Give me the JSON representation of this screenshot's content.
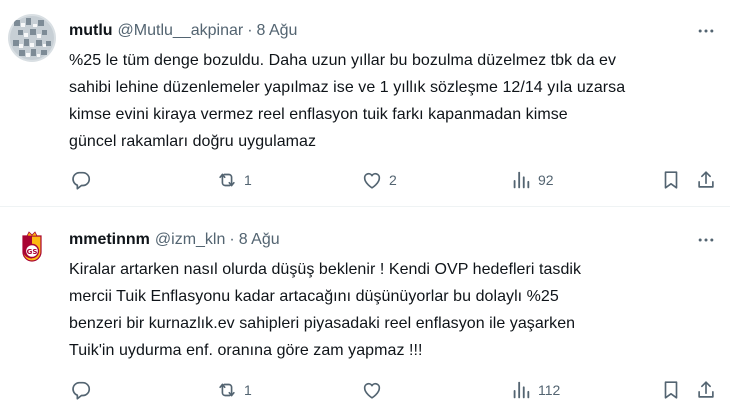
{
  "tweets": [
    {
      "author_name": "mutlu",
      "handle": "@Mutlu__akpinar",
      "separator": "·",
      "date": "8 Ağu",
      "lines": [
        "%25 le tüm denge bozuldu. Daha uzun yıllar bu bozulma düzelmez tbk da ev",
        "sahibi lehine düzenlemeler yapılmaz ise ve 1 yıllık sözleşme 12/14 yıla uzarsa",
        "kimse evini kiraya vermez reel enflasyon tuik farkı kapanmadan kimse",
        "güncel rakamları doğru uygulamaz"
      ],
      "reply_count": "",
      "retweet_count": "1",
      "like_count": "2",
      "view_count": "92",
      "avatar_icon": "geometric-mosaic-avatar"
    },
    {
      "author_name": "mmetinnm",
      "handle": "@izm_kln",
      "separator": "·",
      "date": "8 Ağu",
      "lines": [
        "Kiralar artarken nasıl olurda düşüş beklenir ! Kendi OVP hedefleri tasdik",
        "mercii Tuik  Enflasyonu kadar artacağını düşünüyorlar bu dolaylı %25",
        "benzeri bir kurnazlık.ev sahipleri piyasadaki reel enflasyon ile yaşarken",
        "Tuik'in uydurma enf. oranına göre zam yapmaz !!!"
      ],
      "reply_count": "",
      "retweet_count": "1",
      "like_count": "",
      "view_count": "112",
      "avatar_icon": "galatasaray-crest-avatar"
    }
  ],
  "colors": {
    "text_primary": "#0f1419",
    "text_secondary": "#536471",
    "divider": "#eff3f4",
    "gs_red": "#a90432",
    "gs_yellow": "#fdb912"
  },
  "icons": [
    "reply-icon",
    "retweet-icon",
    "like-icon",
    "views-icon",
    "bookmark-icon",
    "share-icon",
    "more-icon"
  ]
}
